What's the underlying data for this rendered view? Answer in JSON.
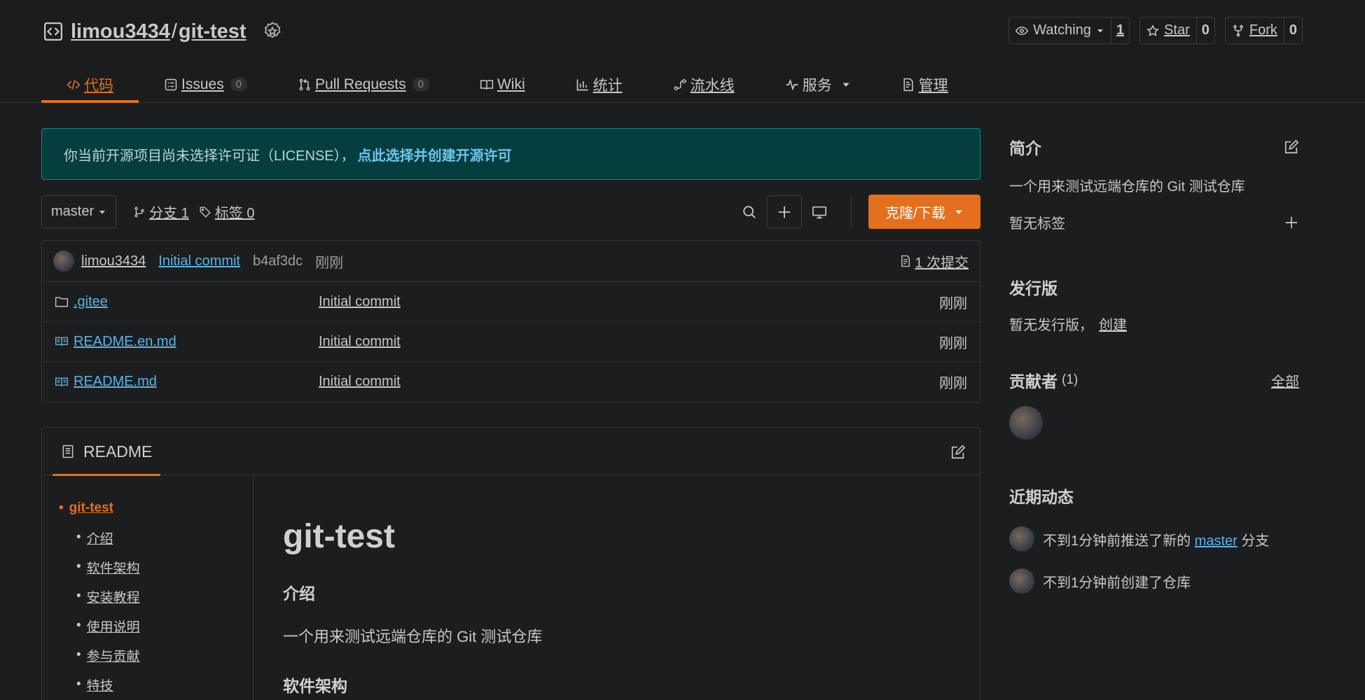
{
  "repo": {
    "owner": "limou3434",
    "separator": "/",
    "name": "git-test"
  },
  "actions": {
    "watch": {
      "label": "Watching",
      "count": "1"
    },
    "star": {
      "label": "Star",
      "count": "0"
    },
    "fork": {
      "label": "Fork",
      "count": "0"
    }
  },
  "tabs": [
    {
      "label": "代码",
      "icon": "code-icon",
      "active": true
    },
    {
      "label": "Issues",
      "badge": "0",
      "icon": "issues-icon"
    },
    {
      "label": "Pull Requests",
      "badge": "0",
      "icon": "pull-request-icon"
    },
    {
      "label": "Wiki",
      "icon": "book-icon"
    },
    {
      "label": "统计",
      "icon": "bar-chart-icon"
    },
    {
      "label": "流水线",
      "icon": "pipeline-icon"
    },
    {
      "label": "服务",
      "icon": "pulse-icon"
    },
    {
      "label": "管理",
      "icon": "settings-doc-icon"
    }
  ],
  "license": {
    "text": "你当前开源项目尚未选择许可证（LICENSE），",
    "link": "点此选择并创建开源许可"
  },
  "toolbar": {
    "branch": "master",
    "branches": "分支 1",
    "tags": "标签 0",
    "clone": "克隆/下载"
  },
  "latest_commit": {
    "author": "limou3434",
    "message": "Initial commit",
    "hash": "b4af3dc",
    "time": "刚刚",
    "commits": "1 次提交"
  },
  "files": [
    {
      "name": ".gitee",
      "type": "folder",
      "commit": "Initial commit",
      "time": "刚刚"
    },
    {
      "name": "README.en.md",
      "type": "file",
      "commit": "Initial commit",
      "time": "刚刚"
    },
    {
      "name": "README.md",
      "type": "file",
      "commit": "Initial commit",
      "time": "刚刚"
    }
  ],
  "readme": {
    "tab": "README",
    "toc": [
      {
        "label": "git-test",
        "level": 1
      },
      {
        "label": "介绍",
        "level": 2
      },
      {
        "label": "软件架构",
        "level": 2
      },
      {
        "label": "安装教程",
        "level": 2
      },
      {
        "label": "使用说明",
        "level": 2
      },
      {
        "label": "参与贡献",
        "level": 2
      },
      {
        "label": "特技",
        "level": 2
      }
    ],
    "title": "git-test",
    "intro_heading": "介绍",
    "intro_text": "一个用来测试远端仓库的 Git 测试仓库",
    "arch_heading": "软件架构"
  },
  "sidebar": {
    "about_title": "简介",
    "description": "一个用来测试远端仓库的 Git 测试仓库",
    "no_tags": "暂无标签",
    "releases_title": "发行版",
    "no_releases": "暂无发行版，",
    "create_link": "创建",
    "contributors_title": "贡献者",
    "contributors_count": "(1)",
    "all_link": "全部",
    "activity_title": "近期动态",
    "activity": [
      {
        "prefix": "不到1分钟前推送了新的 ",
        "link": "master",
        "suffix": " 分支"
      },
      {
        "prefix": "不到1分钟前创建了仓库"
      }
    ]
  },
  "colors": {
    "accent": "#e46f1d",
    "link": "#5ab4e6",
    "license_bg": "#053e3e"
  }
}
